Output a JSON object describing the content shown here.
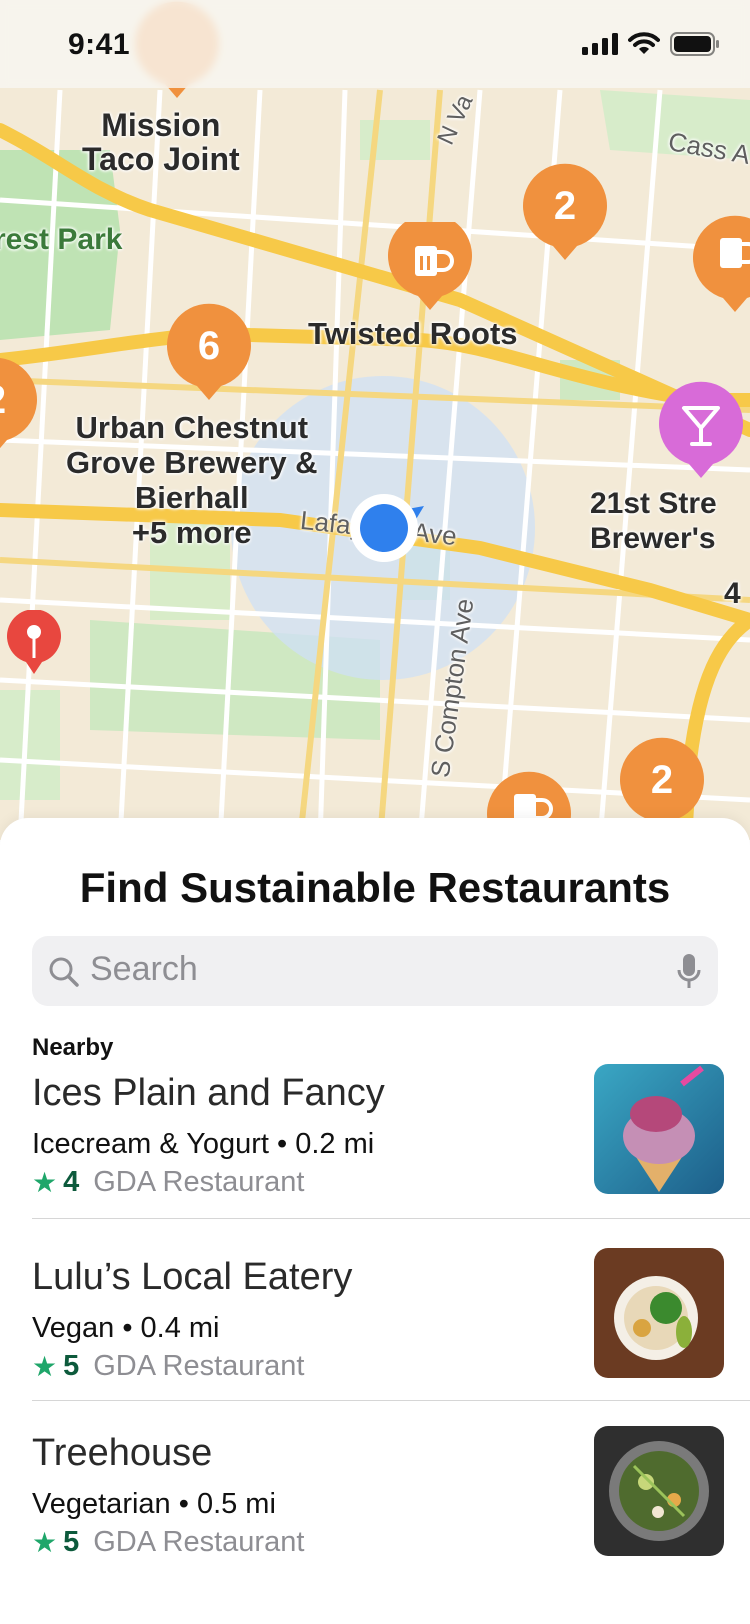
{
  "status_bar": {
    "time": "9:41"
  },
  "map": {
    "labels": {
      "mission": "Mission\nTaco Joint",
      "park": "rest Park",
      "twisted": "Twisted Roots",
      "urban": "Urban Chestnut\nGrove Brewery &\nBierhall\n+5 more",
      "twentyfirst": "21st Stre\nBrewer's",
      "street_lafayette": "Lafayette Ave",
      "street_compton": "S Compton Ave",
      "street_nva": "N Va",
      "street_cass": "Cass A",
      "edge_four": "4",
      "edge_two": "2"
    },
    "clusters": {
      "top": "2",
      "left": "6",
      "bottom": "2"
    },
    "colors": {
      "orange_pin": "#f0913e",
      "pink_pin": "#d86bd8",
      "red_pin": "#e8473f",
      "user_dot": "#2f80ed"
    },
    "icons": {
      "beer": "beer-mug-icon",
      "cocktail": "cocktail-glass-icon",
      "pushpin": "pushpin-icon"
    }
  },
  "sheet": {
    "title": "Find Sustainable Restaurants",
    "search": {
      "placeholder": "Search"
    },
    "section_label": "Nearby",
    "restaurants": [
      {
        "name": "Ices Plain and Fancy",
        "meta": "Icecream & Yogurt • 0.2 mi",
        "rating": "4",
        "rating_label": "GDA Restaurant"
      },
      {
        "name": "Lulu’s Local Eatery",
        "meta": "Vegan • 0.4 mi",
        "rating": "5",
        "rating_label": "GDA Restaurant"
      },
      {
        "name": "Treehouse",
        "meta": "Vegetarian • 0.5 mi",
        "rating": "5",
        "rating_label": "GDA Restaurant"
      }
    ]
  }
}
